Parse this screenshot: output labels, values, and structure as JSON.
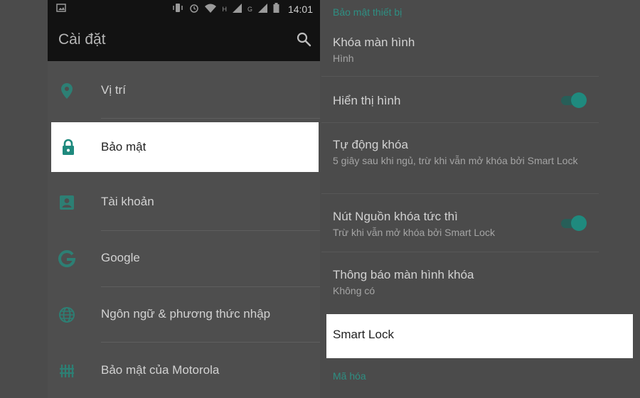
{
  "status_bar": {
    "time": "14:01",
    "net_h1": "H",
    "net_h2": "G"
  },
  "toolbar": {
    "title": "Cài đặt"
  },
  "left_menu": {
    "items": [
      {
        "label": "Vị trí",
        "icon": "location-pin-icon"
      },
      {
        "label": "Bảo mật",
        "icon": "lock-icon",
        "selected": true
      },
      {
        "label": "Tài khoản",
        "icon": "account-icon"
      },
      {
        "label": "Google",
        "icon": "google-icon"
      },
      {
        "label": "Ngôn ngữ & phương thức nhập",
        "icon": "globe-icon"
      },
      {
        "label": "Bảo mật của Motorola",
        "icon": "grid-lock-icon"
      }
    ]
  },
  "right": {
    "section_device_security": "Bảo mật thiết bị",
    "screen_lock": {
      "title": "Khóa màn hình",
      "subtitle": "Hình"
    },
    "show_pattern": {
      "title": "Hiển thị hình",
      "enabled": true
    },
    "auto_lock": {
      "title": "Tự động khóa",
      "subtitle": "5 giây sau khi ngủ, trừ khi vẫn mở khóa bởi Smart Lock"
    },
    "power_button_lock": {
      "title": "Nút Nguồn khóa tức thì",
      "subtitle": "Trừ khi vẫn mở khóa bởi Smart Lock",
      "enabled": true
    },
    "lock_screen_notifications": {
      "title": "Thông báo màn hình khóa",
      "subtitle": "Không có"
    },
    "smart_lock": {
      "title": "Smart Lock"
    },
    "section_encryption": "Mã hóa"
  },
  "colors": {
    "accent": "#1f8a7e",
    "section_header": "#2e8f83",
    "highlight": "#ffffff"
  }
}
